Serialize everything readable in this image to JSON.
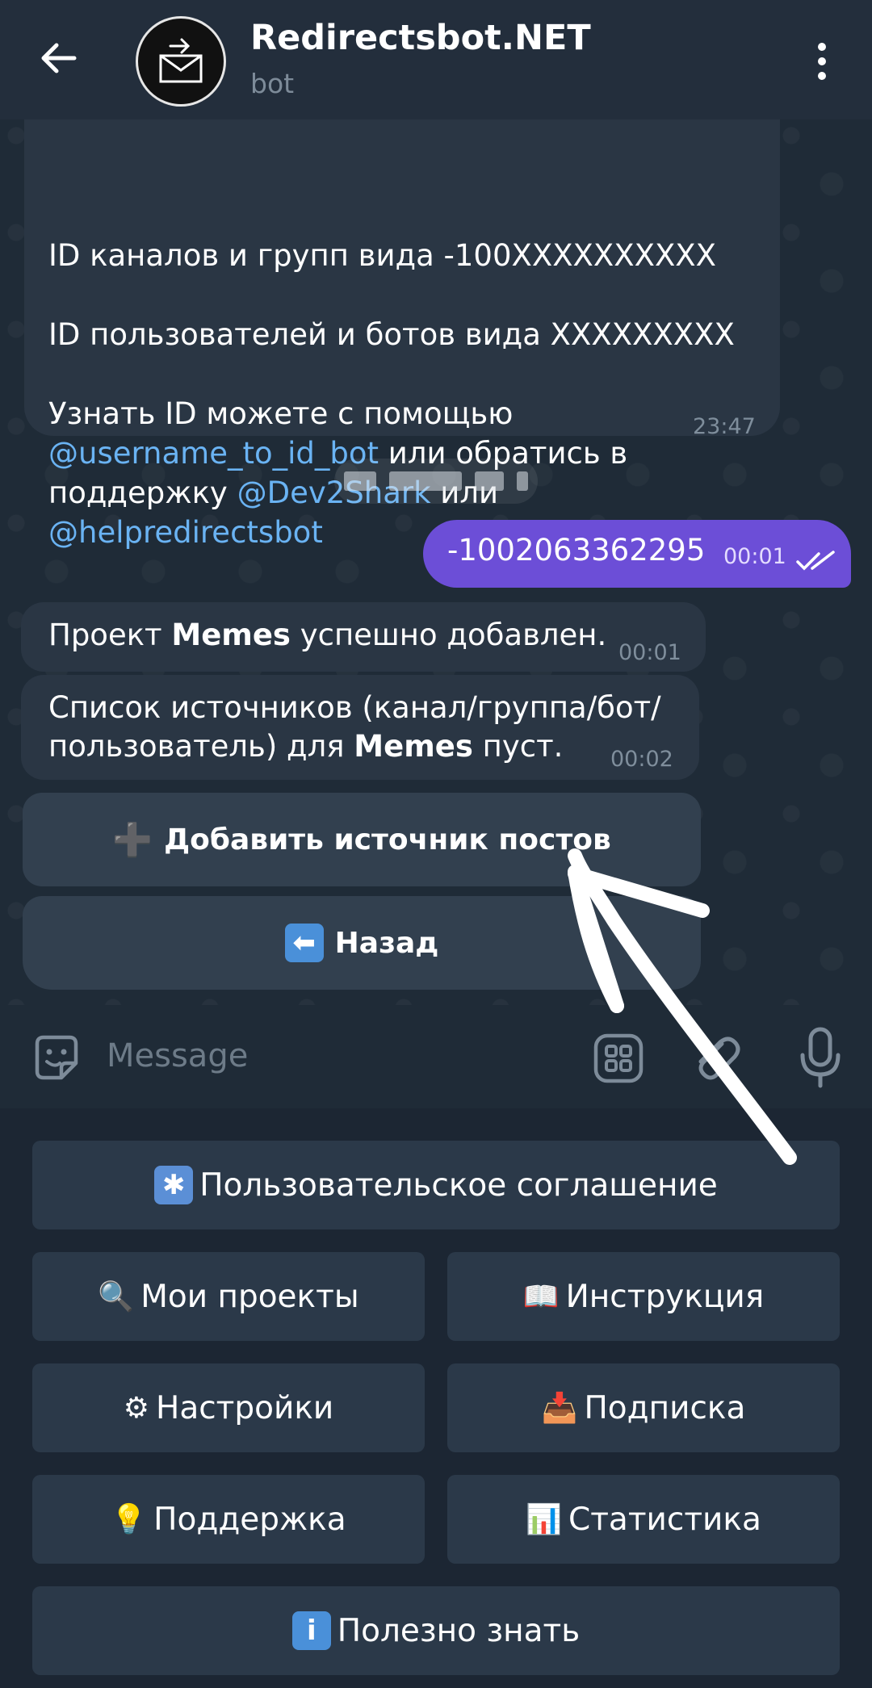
{
  "header": {
    "title": "Redirectsbot.NET",
    "subtitle": "bot"
  },
  "messages": {
    "ids_line1": "ID каналов и групп вида -100XXXXXXXXXX",
    "ids_line2": "ID пользователей и ботов вида XXXXXXXXX",
    "ids_line3_pre": "Узнать ID можете с помощью ",
    "ids_link1": "@username_to_id_bot",
    "ids_line3_mid": " или обратись в поддержку ",
    "ids_link2": "@Dev2Shark",
    "ids_line3_or": " или ",
    "ids_link3": "@helpredirectsbot",
    "ids_time": "23:47",
    "outgoing_text": "-1002063362295",
    "outgoing_time": "00:01",
    "added_pre": "Проект ",
    "added_bold": "Memes",
    "added_post": " успешно добавлен.",
    "added_time": "00:01",
    "list_line1": "Список источников (канал/группа/бот/",
    "list_line2_pre": "пользователь) для ",
    "list_bold": "Memes",
    "list_line2_post": " пуст.",
    "list_time": "00:02"
  },
  "inline_buttons": {
    "add_source": "Добавить источник постов",
    "back": "Назад"
  },
  "composer": {
    "placeholder": "Message"
  },
  "keyboard": {
    "agreement": "Пользовательское соглашение",
    "my_projects": "Мои проекты",
    "instructions": "Инструкция",
    "settings": "Настройки",
    "subscription": "Подписка",
    "support": "Поддержка",
    "statistics": "Статистика",
    "useful": "Полезно знать"
  },
  "colors": {
    "header_bg": "#232e3c",
    "bubble_in": "#2a3644",
    "bubble_out": "#6c4ed7",
    "link": "#6ab3f3",
    "keyboard_btn": "#2b3949"
  }
}
